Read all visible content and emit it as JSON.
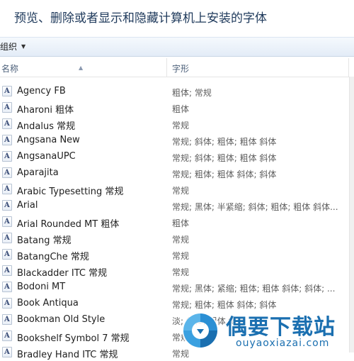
{
  "header": {
    "title": "预览、删除或者显示和隐藏计算机上安装的字体"
  },
  "toolbar": {
    "organize_label": "组织",
    "organize_caret": "▼"
  },
  "columns": {
    "name": "名称",
    "style": "字形",
    "extra": "",
    "sort_indicator": "▲"
  },
  "fonts": [
    {
      "name": "Agency FB",
      "style": "粗体; 常规"
    },
    {
      "name": "Aharoni 粗体",
      "style": "粗体"
    },
    {
      "name": "Andalus 常规",
      "style": "常规"
    },
    {
      "name": "Angsana New",
      "style": "常规; 斜体; 粗体; 粗体 斜体"
    },
    {
      "name": "AngsanaUPC",
      "style": "常规; 斜体; 粗体; 粗体 斜体"
    },
    {
      "name": "Aparajita",
      "style": "常规; 粗体; 粗体 斜体; 斜体"
    },
    {
      "name": "Arabic Typesetting 常规",
      "style": "常规"
    },
    {
      "name": "Arial",
      "style": "常规; 黑体; 半紧缩; 斜体; 粗体; 粗体 斜体..."
    },
    {
      "name": "Arial Rounded MT 粗体",
      "style": "粗体"
    },
    {
      "name": "Batang 常规",
      "style": "常规"
    },
    {
      "name": "BatangChe 常规",
      "style": "常规"
    },
    {
      "name": "Blackadder ITC 常规",
      "style": "常规"
    },
    {
      "name": "Bodoni MT",
      "style": "常规; 黑体; 紧缩; 粗体; 粗体 斜体; 斜体; ..."
    },
    {
      "name": "Book Antiqua",
      "style": "常规; 粗体; 粗体 斜体; 斜体"
    },
    {
      "name": "Bookman Old Style",
      "style": "淡; 斜体; 粗体 斜体"
    },
    {
      "name": "Bookshelf Symbol 7 常规",
      "style": "常规"
    },
    {
      "name": "Bradley Hand ITC 常规",
      "style": "常规"
    }
  ],
  "watermark": {
    "title": "偶要下载站",
    "subtitle": "ouyaoxiazai.com"
  },
  "colors": {
    "title": "#1e395b",
    "toolbar_top": "#f5f9fd",
    "toolbar_bottom": "#e3ecf7",
    "header_text": "#4c607a",
    "watermark": "#1a6fb0"
  }
}
